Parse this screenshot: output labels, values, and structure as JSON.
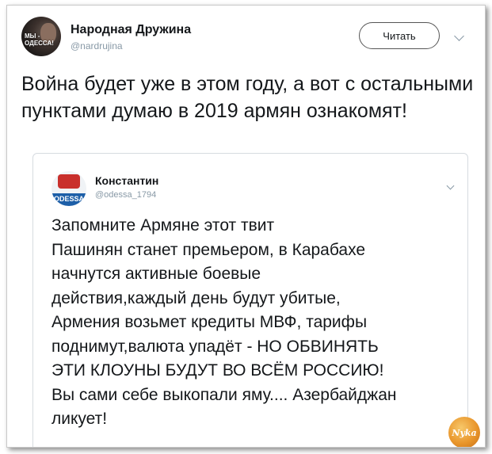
{
  "tweet": {
    "author_name": "Народная Дружина",
    "author_handle": "@nardrujina",
    "avatar_text": "МЫ - ОДЕССА!",
    "follow_label": "Читать",
    "text": "Война будет уже в этом году, а вот с остальными пунктами думаю в 2019 армян ознакомят!"
  },
  "quoted_tweet": {
    "author_name": "Константин",
    "author_handle": "@odessa_1794",
    "avatar_text": "ODESSA",
    "lines": [
      "Запомните Армяне этот твит",
      "Пашинян станет премьером, в Карабахе",
      "начнутся активные боевые",
      "действия,каждый день будут убитые,",
      "Армения возьмет кредиты МВФ, тарифы",
      "поднимут,валюта упадёт - НО ОБВИНЯТЬ",
      "ЭТИ КЛОУНЫ БУДУТ ВО ВСЁМ РОССИЮ!",
      "Вы сами себе выкопали яму.... Азербайджан",
      "ликует!"
    ]
  },
  "watermark_text": "Nyka",
  "icons": {
    "more_main": "chevron-down-icon",
    "more_quote": "chevron-down-icon"
  }
}
